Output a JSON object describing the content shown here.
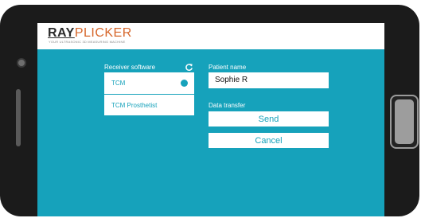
{
  "brand": {
    "logo_prefix": "RAY",
    "logo_suffix": "PLICKER",
    "tagline": "YOUR ULTRASONIC 3D MEASURING MACHINE"
  },
  "receiver": {
    "label": "Receiver software",
    "refresh_icon": "refresh-icon",
    "options": [
      {
        "label": "TCM",
        "selected": true
      },
      {
        "label": "TCM Prosthetist",
        "selected": false
      }
    ]
  },
  "patient": {
    "label": "Patient name",
    "value": "Sophie R"
  },
  "transfer": {
    "label": "Data transfer",
    "send_label": "Send",
    "cancel_label": "Cancel"
  },
  "colors": {
    "accent": "#16a2bb",
    "device_frame": "#1b1b1b",
    "logo_accent": "#d6662a"
  }
}
